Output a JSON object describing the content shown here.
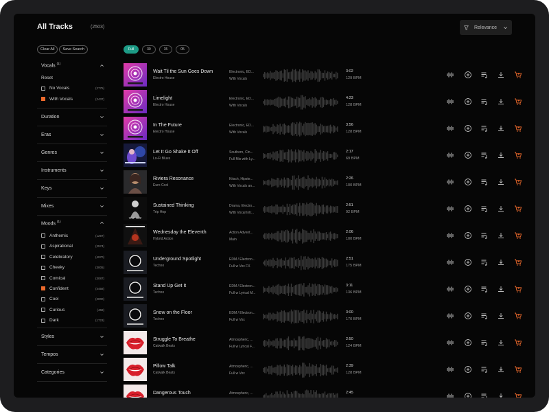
{
  "header": {
    "title": "All Tracks",
    "count": "(2503)",
    "sort_label": "Relevance"
  },
  "sidebar": {
    "clear_all": "Clear All",
    "save_search": "Save Search",
    "vocals": {
      "label": "Vocals",
      "badge": "(1)",
      "reset": "Reset",
      "options": [
        {
          "label": "No Vocals",
          "count": "(2775)",
          "checked": false
        },
        {
          "label": "With Vocals",
          "count": "(2437)",
          "checked": true
        }
      ]
    },
    "sections_top": [
      "Duration",
      "Eras",
      "Genres",
      "Instruments",
      "Keys",
      "Mixes"
    ],
    "moods": {
      "label": "Moods",
      "badge": "(1)",
      "options": [
        {
          "label": "Anthemic",
          "count": "(1297)",
          "checked": false
        },
        {
          "label": "Aspirational",
          "count": "(2574)",
          "checked": false
        },
        {
          "label": "Celebratory",
          "count": "(4970)",
          "checked": false
        },
        {
          "label": "Cheeky",
          "count": "(3005)",
          "checked": false
        },
        {
          "label": "Comical",
          "count": "(3087)",
          "checked": false
        },
        {
          "label": "Confident",
          "count": "(4458)",
          "checked": true
        },
        {
          "label": "Cool",
          "count": "(2000)",
          "checked": false
        },
        {
          "label": "Curious",
          "count": "(468)",
          "checked": false
        },
        {
          "label": "Dark",
          "count": "(1723)",
          "checked": false
        }
      ]
    },
    "sections_bottom": [
      "Styles",
      "Tempos",
      "Categories"
    ]
  },
  "chips": [
    "Full",
    "30",
    "15",
    "05"
  ],
  "tracks": [
    {
      "title": "Wait Til the Sun Goes Down",
      "artist": "Electro House",
      "genre": "Electronic, ED...",
      "mix": "With Vocals",
      "time": "3:02",
      "bpm": "129 BPM",
      "art": "mag"
    },
    {
      "title": "Limelight",
      "artist": "Electro House",
      "genre": "Electronic, ED...",
      "mix": "With Vocals",
      "time": "4:23",
      "bpm": "128 BPM",
      "art": "mag"
    },
    {
      "title": "In The Future",
      "artist": "Electro House",
      "genre": "Electronic, ED...",
      "mix": "With Vocals",
      "time": "3:56",
      "bpm": "128 BPM",
      "art": "mag"
    },
    {
      "title": "Let It Go Shake It Off",
      "artist": "Lo-Fi Blues",
      "genre": "Southern, Cin...",
      "mix": "Full Mix with Ly...",
      "time": "2:17",
      "bpm": "69 BPM",
      "art": "blue"
    },
    {
      "title": "Riviera Resonance",
      "artist": "Euro Cool",
      "genre": "Kitsch, Hipste...",
      "mix": "With Vocals an...",
      "time": "2:26",
      "bpm": "100 BPM",
      "art": "euro"
    },
    {
      "title": "Sustained Thinking",
      "artist": "Trip Hop",
      "genre": "Drama, Electro...",
      "mix": "With Vocal Intr...",
      "time": "2:51",
      "bpm": "92 BPM",
      "art": "trip"
    },
    {
      "title": "Wednesday the Eleventh",
      "artist": "Hybrid Action",
      "genre": "Action Advent...",
      "mix": "Main",
      "time": "2:06",
      "bpm": "100 BPM",
      "art": "hybrid"
    },
    {
      "title": "Underground Spotlight",
      "artist": "Techno",
      "genre": "EDM / Electron...",
      "mix": "Full w Vox FX",
      "time": "2:51",
      "bpm": "175 BPM",
      "art": "techno"
    },
    {
      "title": "Stand Up Get It",
      "artist": "Techno",
      "genre": "EDM / Electron...",
      "mix": "Full w Lyrical M...",
      "time": "3:11",
      "bpm": "136 BPM",
      "art": "techno"
    },
    {
      "title": "Snow on the Floor",
      "artist": "Techno",
      "genre": "EDM / Electron...",
      "mix": "Full w Vox",
      "time": "3:00",
      "bpm": "170 BPM",
      "art": "techno"
    },
    {
      "title": "Struggle To Breathe",
      "artist": "Catwalk Beats",
      "genre": "Atmospheric, ...",
      "mix": "Full w Lyrical F...",
      "time": "2:50",
      "bpm": "124 BPM",
      "art": "lips"
    },
    {
      "title": "Pillow Talk",
      "artist": "Catwalk Beats",
      "genre": "Atmospheric, ...",
      "mix": "Full w Vox",
      "time": "2:39",
      "bpm": "128 BPM",
      "art": "lips"
    },
    {
      "title": "Dangerous Touch",
      "artist": "Catwalk Beats",
      "genre": "Atmospheric, ...",
      "mix": "",
      "time": "2:45",
      "bpm": "",
      "art": "lips"
    }
  ],
  "colors": {
    "accent": "#1d9b86",
    "checked": "#ec6a2c",
    "cart": "#ec6a2c"
  },
  "icons": [
    "similar-icon",
    "add-icon",
    "playlist-icon",
    "download-icon",
    "cart-icon"
  ]
}
